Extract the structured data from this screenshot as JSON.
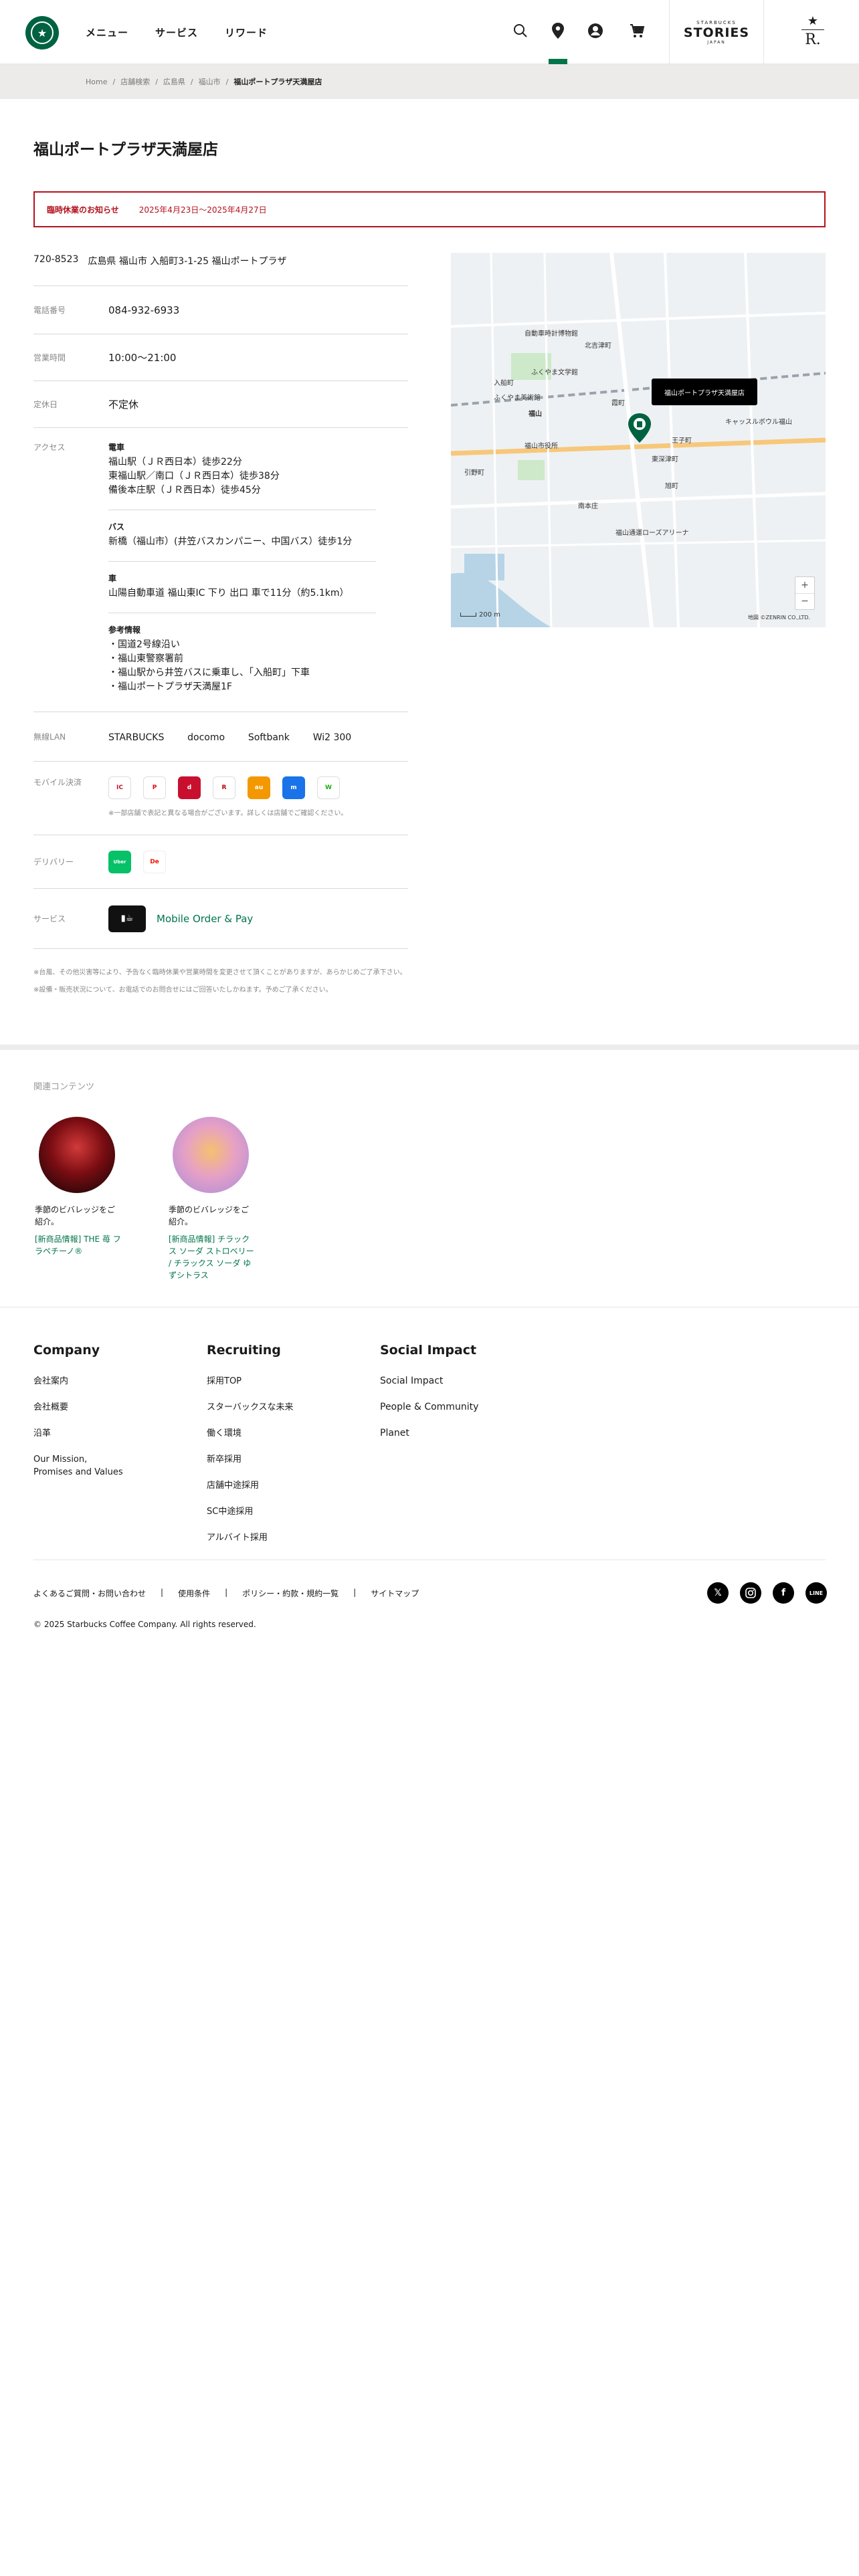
{
  "header": {
    "nav": [
      "メニュー",
      "サービス",
      "リワード"
    ],
    "stories_top": "STARBUCKS",
    "stories_main": "STORIES",
    "stories_bottom": "JAPAN",
    "reserve_letter": "R."
  },
  "breadcrumb": [
    "Home",
    "店舗検索",
    "広島県",
    "福山市",
    "福山ポートプラザ天満屋店"
  ],
  "store": {
    "name": "福山ポートプラザ天満屋店",
    "notice_title": "臨時休業のお知らせ",
    "notice_text": "2025年4月23日〜2025年4月27日",
    "postal": "720-8523",
    "address": "広島県 福山市 入船町3-1-25 福山ポートプラザ",
    "phone_label": "電話番号",
    "phone": "084-932-6933",
    "hours_label": "営業時間",
    "hours": "10:00〜21:00",
    "holiday_label": "定休日",
    "holiday": "不定休",
    "access_label": "アクセス",
    "access": {
      "train_h": "電車",
      "train_1": "福山駅（ＪＲ西日本）徒歩22分",
      "train_2": "東福山駅／南口（ＪＲ西日本）徒歩38分",
      "train_3": "備後本庄駅（ＪＲ西日本）徒歩45分",
      "bus_h": "バス",
      "bus_1": "新橋（福山市）(井笠バスカンパニー、中国バス）徒歩1分",
      "car_h": "車",
      "car_1": "山陽自動車道 福山東IC 下り 出口 車で11分（約5.1km）",
      "ref_h": "参考情報",
      "ref_1": "・国道2号線沿い",
      "ref_2": "・福山東警察署前",
      "ref_3": "・福山駅から井笠バスに乗車し、「入船町」下車",
      "ref_4": "・福山ポートプラザ天満屋1F"
    },
    "wifi_label": "無線LAN",
    "wifi": [
      "STARBUCKS",
      "docomo",
      "Softbank",
      "Wi2 300"
    ],
    "mobile_label": "モバイル決済",
    "mobile_note": "※一部店舗で表記と異なる場合がございます。詳しくは店舗でご確認ください。",
    "delivery_label": "デリバリー",
    "service_label": "サービス",
    "service": "Mobile Order & Pay",
    "footnote_1": "※台風、その他災害等により、予告なく臨時休業や営業時間を変更させて頂くことがありますが、あらかじめご了承下さい。",
    "footnote_2": "※設備・販売状況について、お電話でのお問合せにはご回答いたしかねます。予めご了承ください。"
  },
  "map": {
    "tooltip": "福山ポートプラザ天満屋店",
    "scale": "200 m",
    "copyright": "地図 ©ZENRIN CO.,LTD.",
    "labels": [
      "自動車時計博物館",
      "ふくやま文学館",
      "入船町",
      "ふくやま美術館",
      "福山市役所",
      "福山",
      "王子町",
      "霞町",
      "キャッスルボウル福山",
      "福山通運ローズアリーナ",
      "東深津町",
      "南本庄",
      "北吉津町",
      "引野町",
      "旭町"
    ],
    "colors": {
      "water": "#b6d4e6",
      "park": "#cde9c9",
      "road": "#ffffff",
      "pin": "#006241"
    }
  },
  "related": {
    "heading": "関連コンテンツ",
    "cards": [
      {
        "caption": "季節のビバレッジをご紹介。",
        "link": "[新商品情報] THE 苺 フラペチーノ®"
      },
      {
        "caption": "季節のビバレッジをご紹介。",
        "link": "[新商品情報] チラックス ソーダ ストロベリー / チラックス ソーダ ゆずシトラス"
      }
    ]
  },
  "footer": {
    "company_h": "Company",
    "company": [
      "会社案内",
      "会社概要",
      "沿革",
      "Our Mission,\nPromises and Values"
    ],
    "recruit_h": "Recruiting",
    "recruit": [
      "採用TOP",
      "スターバックスな未来",
      "働く環境",
      "新卒採用",
      "店舗中途採用",
      "SC中途採用",
      "アルバイト採用"
    ],
    "impact_h": "Social Impact",
    "impact": [
      "Social Impact",
      "People & Community",
      "Planet"
    ],
    "links": [
      "よくあるご質問・お問い合わせ",
      "使用条件",
      "ポリシー・約款・規約一覧",
      "サイトマップ"
    ],
    "copyright": "© 2025 Starbucks Coffee Company. All rights reserved."
  },
  "colors": {
    "brand": "#006241",
    "accent": "#00754a",
    "alert": "#b3121e"
  }
}
